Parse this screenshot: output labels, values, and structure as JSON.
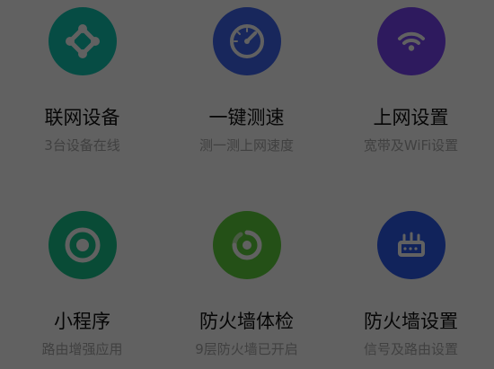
{
  "tiles": [
    {
      "title": "联网设备",
      "subtitle": "3台设备在线",
      "icon": "network-devices-icon",
      "color": "#12c7b4"
    },
    {
      "title": "一键测速",
      "subtitle": "测一测上网速度",
      "icon": "speedometer-icon",
      "color": "#3f67f2"
    },
    {
      "title": "上网设置",
      "subtitle": "宽带及WiFi设置",
      "icon": "wifi-icon",
      "color": "#7a45f6"
    },
    {
      "title": "小程序",
      "subtitle": "路由增强应用",
      "icon": "mini-program-icon",
      "color": "#19c58e"
    },
    {
      "title": "防火墙体检",
      "subtitle": "9层防火墙已开启",
      "icon": "firewall-check-icon",
      "color": "#60d23e"
    },
    {
      "title": "防火墙设置",
      "subtitle": "信号及路由设置",
      "icon": "router-settings-icon",
      "color": "#2f5cf0"
    }
  ],
  "overlay_color": "rgba(0,0,0,0.62)"
}
